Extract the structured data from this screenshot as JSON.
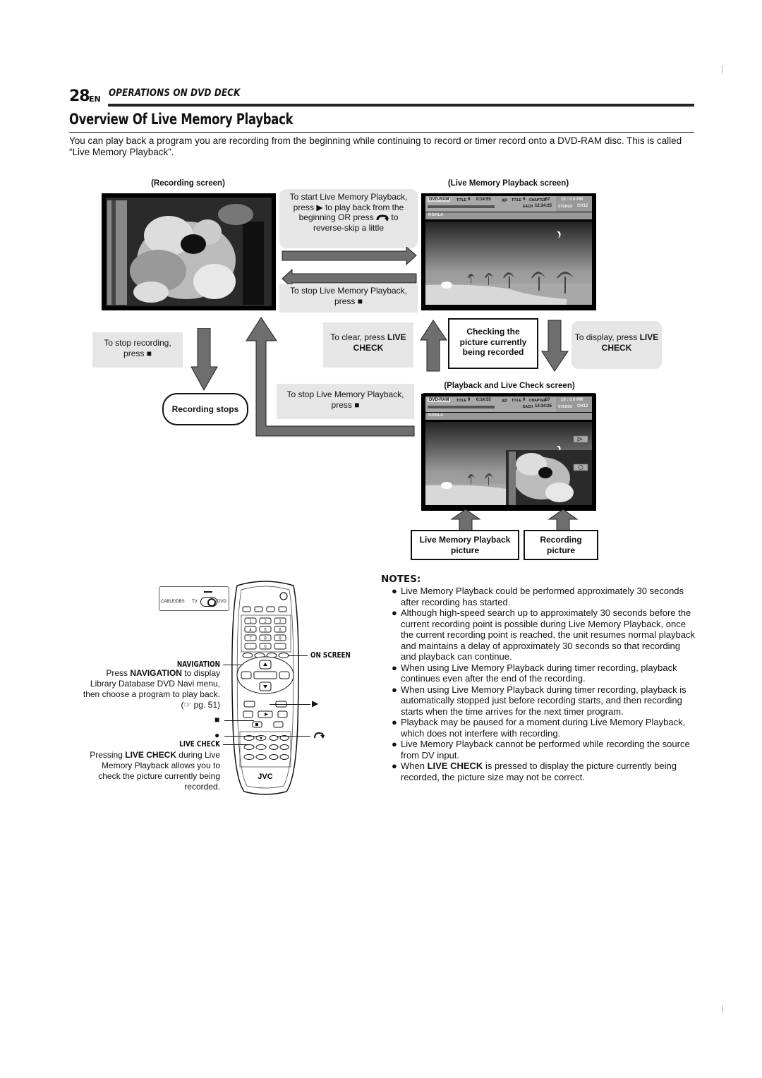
{
  "header": {
    "page_number": "28",
    "language": "EN",
    "section": "OPERATIONS ON DVD DECK"
  },
  "title": "Overview Of Live Memory Playback",
  "intro": "You can play back a program you are recording from the beginning while continuing to record or timer record onto a DVD-RAM disc. This is called “Live Memory Playback”.",
  "diagram": {
    "recording_screen_caption": "(Recording screen)",
    "live_memory_screen_caption": "(Live Memory Playback screen)",
    "playback_live_check_caption": "(Playback and Live Check screen)",
    "start_box": {
      "line1": "To start Live Memory Playback,",
      "line2_pre": "press",
      "line2_post": "to play back from the",
      "line3_pre": "beginning OR press",
      "line3_post": "to",
      "line4": "reverse-skip a little"
    },
    "stop_box_top": {
      "line1": "To stop Live Memory Playback,",
      "line2": "press"
    },
    "stop_recording_box": {
      "line1": "To stop recording,",
      "line2": "press"
    },
    "recording_stops": "Recording stops",
    "clear_box": {
      "pre": "To clear, press",
      "bold1": "LIVE",
      "bold2": "CHECK"
    },
    "checking_box": {
      "line1": "Checking the",
      "line2": "picture currently",
      "line3": "being recorded"
    },
    "display_box": {
      "pre": "To display, press",
      "bold1": "LIVE",
      "bold2": "CHECK"
    },
    "stop_box_bottom": {
      "line1": "To stop Live Memory Playback,",
      "line2": "press"
    },
    "live_memory_picture_label": {
      "line1": "Live Memory Playback",
      "line2": "picture"
    },
    "recording_picture_label": {
      "line1": "Recording",
      "line2": "picture"
    },
    "osd": {
      "disc": "DVD-RAM",
      "title_label": "TITLE",
      "title_num": "9",
      "elapsed": "0:14:55",
      "mode": "XP",
      "title2_label": "TITLE",
      "title2_num": "9",
      "chapter_label": "CHAPTER",
      "chapter_num": "67",
      "each_label": "EACH",
      "each_time": "12:34:25",
      "clock": "10 : 0 0 PM",
      "audio": "STEREO",
      "channel": "CH12",
      "program_name": "KOALA"
    }
  },
  "remote": {
    "switch_labels": {
      "cable": "CABLE/DBS",
      "tv": "TV",
      "dvd": "DVD"
    },
    "brand": "JVC",
    "number_keys": [
      "1",
      "2",
      "3",
      "4",
      "5",
      "6",
      "7",
      "8",
      "9",
      "",
      "0",
      ""
    ],
    "callouts": {
      "on_screen": "ON SCREEN",
      "navigation_label": "NAVIGATION",
      "navigation_text_pre": "Press",
      "navigation_text_bold": "NAVIGATION",
      "navigation_text_post": "to display",
      "navigation_line2": "Library Database DVD Navi menu,",
      "navigation_line3": "then choose a program to play back.",
      "navigation_ref": "(☞ pg. 51)",
      "stop_symbol": "■",
      "record_symbol": "●",
      "play_symbol": "▶",
      "skip_symbol": "↶",
      "live_check_label": "LIVE CHECK",
      "live_check_pre": "Pressing",
      "live_check_bold": "LIVE CHECK",
      "live_check_post": "during Live",
      "live_check_line2": "Memory Playback allows you to",
      "live_check_line3": "check the picture currently being",
      "live_check_line4": "recorded."
    }
  },
  "notes": {
    "title": "NOTES:",
    "items": [
      {
        "text": "Live Memory Playback could be performed approximately 30 seconds after recording has started."
      },
      {
        "text": "Although high-speed search up to approximately 30 seconds before the current recording point is possible during Live Memory Playback, once the current recording point is reached, the unit resumes normal playback and maintains a delay of approximately 30 seconds so that recording and playback can continue."
      },
      {
        "text": "When using Live Memory Playback during timer recording, playback continues even after the end of the recording."
      },
      {
        "text": "When using Live Memory Playback during timer recording, playback is automatically stopped just before recording starts, and then recording starts when the time arrives for the next timer program."
      },
      {
        "text": "Playback may be paused for a moment during Live Memory Playback, which does not interfere with recording."
      },
      {
        "text": "Live Memory Playback cannot be performed while recording the source from DV input."
      },
      {
        "pre": "When",
        "bold": "LIVE CHECK",
        "post": "is pressed to display the picture currently being recorded, the picture size may not be correct."
      }
    ]
  },
  "symbols": {
    "play": "▶",
    "stop": "■",
    "bullet": "●"
  }
}
